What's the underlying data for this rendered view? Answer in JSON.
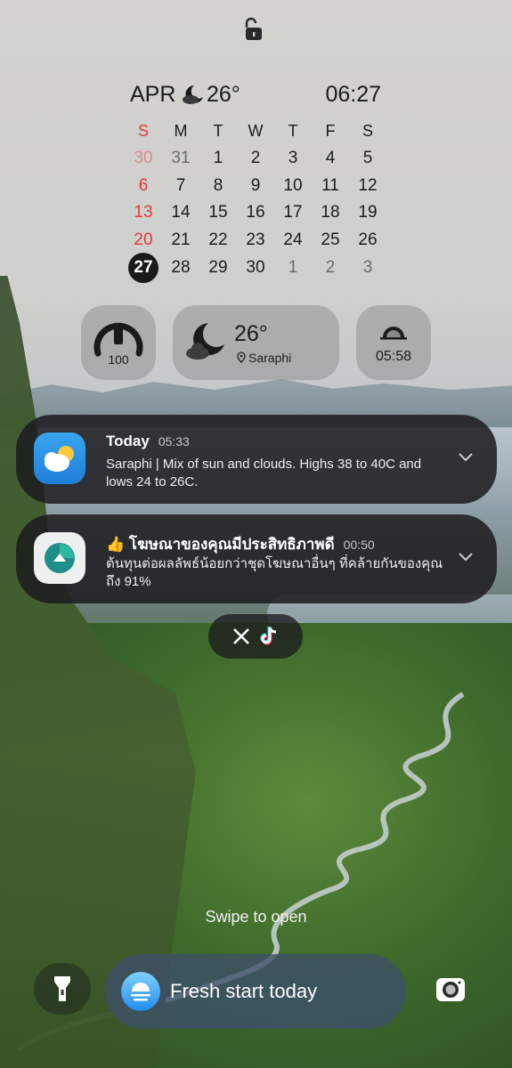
{
  "calendar": {
    "month": "APR",
    "temp": "26°",
    "time": "06:27",
    "weekdays": [
      "S",
      "M",
      "T",
      "W",
      "T",
      "F",
      "S"
    ],
    "weeks": [
      [
        "30",
        "31",
        "1",
        "2",
        "3",
        "4",
        "5"
      ],
      [
        "6",
        "7",
        "8",
        "9",
        "10",
        "11",
        "12"
      ],
      [
        "13",
        "14",
        "15",
        "16",
        "17",
        "18",
        "19"
      ],
      [
        "20",
        "21",
        "22",
        "23",
        "24",
        "25",
        "26"
      ],
      [
        "27",
        "28",
        "29",
        "30",
        "1",
        "2",
        "3"
      ]
    ],
    "today": "27"
  },
  "widgets": {
    "battery_value": "100",
    "weather_temp": "26°",
    "weather_location": "Saraphi",
    "sunrise_time": "05:58"
  },
  "notifications": [
    {
      "app": "weather",
      "title": "Today",
      "time": "05:33",
      "body": "Saraphi | Mix of sun and clouds. Highs 38 to 40C and lows 24 to 26C."
    },
    {
      "app": "ad-app",
      "title": "👍 โฆษณาของคุณมีประสิทธิภาพดี",
      "time": "00:50",
      "body": "ต้นทุนต่อผลลัพธ์น้อยกว่าชุดโฆษณาอื่นๆ ที่คล้ายกันของคุณถึง 91%"
    }
  ],
  "app_icons": [
    "x-icon",
    "tiktok-icon"
  ],
  "swipe_text": "Swipe to open",
  "bottom": {
    "fresh_label": "Fresh start today"
  },
  "colors": {
    "sunday_red": "#e0393b",
    "notification_bg": "#1c1c1e"
  }
}
